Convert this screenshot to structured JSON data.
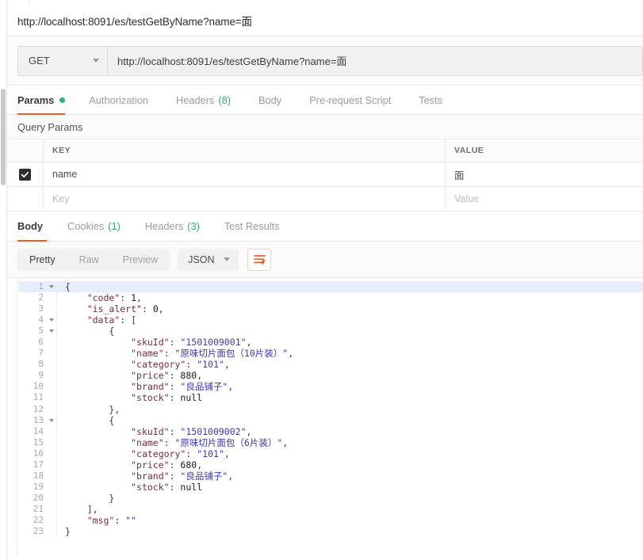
{
  "window": {
    "title_url": "http://localhost:8091/es/testGetByName?name=面"
  },
  "request": {
    "method": "GET",
    "method_caret": "chevron-down-icon",
    "url": "http://localhost:8091/es/testGetByName?name=面",
    "tabs": [
      {
        "label": "Params",
        "active": true,
        "dot": true,
        "count": ""
      },
      {
        "label": "Authorization",
        "active": false,
        "dot": false,
        "count": ""
      },
      {
        "label": "Headers",
        "active": false,
        "dot": false,
        "count": "(8)"
      },
      {
        "label": "Body",
        "active": false,
        "dot": false,
        "count": ""
      },
      {
        "label": "Pre-request Script",
        "active": false,
        "dot": false,
        "count": ""
      },
      {
        "label": "Tests",
        "active": false,
        "dot": false,
        "count": ""
      }
    ]
  },
  "query_params": {
    "section_label": "Query Params",
    "columns": {
      "key": "KEY",
      "value": "VALUE"
    },
    "rows": [
      {
        "checked": true,
        "key": "name",
        "value": "面",
        "placeholder_key": "",
        "placeholder_value": ""
      },
      {
        "checked": false,
        "key": "",
        "value": "",
        "placeholder_key": "Key",
        "placeholder_value": "Value"
      }
    ]
  },
  "response": {
    "tabs": [
      {
        "label": "Body",
        "active": true,
        "count": ""
      },
      {
        "label": "Cookies",
        "active": false,
        "count": "(1)"
      },
      {
        "label": "Headers",
        "active": false,
        "count": "(3)"
      },
      {
        "label": "Test Results",
        "active": false,
        "count": ""
      }
    ],
    "view_modes": [
      {
        "label": "Pretty",
        "active": true
      },
      {
        "label": "Raw",
        "active": false
      },
      {
        "label": "Preview",
        "active": false
      }
    ],
    "format": "JSON",
    "format_caret": "chevron-down-icon",
    "wrap_toggle": "word-wrap-icon",
    "body_lines": [
      {
        "n": 1,
        "fold": true,
        "indent": 0,
        "tokens": [
          {
            "t": "punc",
            "v": "{"
          }
        ]
      },
      {
        "n": 2,
        "fold": false,
        "indent": 1,
        "tokens": [
          {
            "t": "key",
            "v": "\"code\""
          },
          {
            "t": "punc",
            "v": ": "
          },
          {
            "t": "num",
            "v": "1"
          },
          {
            "t": "punc",
            "v": ","
          }
        ]
      },
      {
        "n": 3,
        "fold": false,
        "indent": 1,
        "tokens": [
          {
            "t": "key",
            "v": "\"is_alert\""
          },
          {
            "t": "punc",
            "v": ": "
          },
          {
            "t": "num",
            "v": "0"
          },
          {
            "t": "punc",
            "v": ","
          }
        ]
      },
      {
        "n": 4,
        "fold": true,
        "indent": 1,
        "tokens": [
          {
            "t": "key",
            "v": "\"data\""
          },
          {
            "t": "punc",
            "v": ": ["
          }
        ]
      },
      {
        "n": 5,
        "fold": true,
        "indent": 2,
        "tokens": [
          {
            "t": "punc",
            "v": "{"
          }
        ]
      },
      {
        "n": 6,
        "fold": false,
        "indent": 3,
        "tokens": [
          {
            "t": "key",
            "v": "\"skuId\""
          },
          {
            "t": "punc",
            "v": ": "
          },
          {
            "t": "str",
            "v": "\"1501009001\""
          },
          {
            "t": "punc",
            "v": ","
          }
        ]
      },
      {
        "n": 7,
        "fold": false,
        "indent": 3,
        "tokens": [
          {
            "t": "key",
            "v": "\"name\""
          },
          {
            "t": "punc",
            "v": ": "
          },
          {
            "t": "str",
            "v": "\"原味切片面包（10片装）\""
          },
          {
            "t": "punc",
            "v": ","
          }
        ]
      },
      {
        "n": 8,
        "fold": false,
        "indent": 3,
        "tokens": [
          {
            "t": "key",
            "v": "\"category\""
          },
          {
            "t": "punc",
            "v": ": "
          },
          {
            "t": "str",
            "v": "\"101\""
          },
          {
            "t": "punc",
            "v": ","
          }
        ]
      },
      {
        "n": 9,
        "fold": false,
        "indent": 3,
        "tokens": [
          {
            "t": "key",
            "v": "\"price\""
          },
          {
            "t": "punc",
            "v": ": "
          },
          {
            "t": "num",
            "v": "880"
          },
          {
            "t": "punc",
            "v": ","
          }
        ]
      },
      {
        "n": 10,
        "fold": false,
        "indent": 3,
        "tokens": [
          {
            "t": "key",
            "v": "\"brand\""
          },
          {
            "t": "punc",
            "v": ": "
          },
          {
            "t": "str",
            "v": "\"良品铺子\""
          },
          {
            "t": "punc",
            "v": ","
          }
        ]
      },
      {
        "n": 11,
        "fold": false,
        "indent": 3,
        "tokens": [
          {
            "t": "key",
            "v": "\"stock\""
          },
          {
            "t": "punc",
            "v": ": "
          },
          {
            "t": "null",
            "v": "null"
          }
        ]
      },
      {
        "n": 12,
        "fold": false,
        "indent": 2,
        "tokens": [
          {
            "t": "punc",
            "v": "},"
          }
        ]
      },
      {
        "n": 13,
        "fold": true,
        "indent": 2,
        "tokens": [
          {
            "t": "punc",
            "v": "{"
          }
        ]
      },
      {
        "n": 14,
        "fold": false,
        "indent": 3,
        "tokens": [
          {
            "t": "key",
            "v": "\"skuId\""
          },
          {
            "t": "punc",
            "v": ": "
          },
          {
            "t": "str",
            "v": "\"1501009002\""
          },
          {
            "t": "punc",
            "v": ","
          }
        ]
      },
      {
        "n": 15,
        "fold": false,
        "indent": 3,
        "tokens": [
          {
            "t": "key",
            "v": "\"name\""
          },
          {
            "t": "punc",
            "v": ": "
          },
          {
            "t": "str",
            "v": "\"原味切片面包（6片装）\""
          },
          {
            "t": "punc",
            "v": ","
          }
        ]
      },
      {
        "n": 16,
        "fold": false,
        "indent": 3,
        "tokens": [
          {
            "t": "key",
            "v": "\"category\""
          },
          {
            "t": "punc",
            "v": ": "
          },
          {
            "t": "str",
            "v": "\"101\""
          },
          {
            "t": "punc",
            "v": ","
          }
        ]
      },
      {
        "n": 17,
        "fold": false,
        "indent": 3,
        "tokens": [
          {
            "t": "key",
            "v": "\"price\""
          },
          {
            "t": "punc",
            "v": ": "
          },
          {
            "t": "num",
            "v": "680"
          },
          {
            "t": "punc",
            "v": ","
          }
        ]
      },
      {
        "n": 18,
        "fold": false,
        "indent": 3,
        "tokens": [
          {
            "t": "key",
            "v": "\"brand\""
          },
          {
            "t": "punc",
            "v": ": "
          },
          {
            "t": "str",
            "v": "\"良品铺子\""
          },
          {
            "t": "punc",
            "v": ","
          }
        ]
      },
      {
        "n": 19,
        "fold": false,
        "indent": 3,
        "tokens": [
          {
            "t": "key",
            "v": "\"stock\""
          },
          {
            "t": "punc",
            "v": ": "
          },
          {
            "t": "null",
            "v": "null"
          }
        ]
      },
      {
        "n": 20,
        "fold": false,
        "indent": 2,
        "tokens": [
          {
            "t": "punc",
            "v": "}"
          }
        ]
      },
      {
        "n": 21,
        "fold": false,
        "indent": 1,
        "tokens": [
          {
            "t": "punc",
            "v": "],"
          }
        ]
      },
      {
        "n": 22,
        "fold": false,
        "indent": 1,
        "tokens": [
          {
            "t": "key",
            "v": "\"msg\""
          },
          {
            "t": "punc",
            "v": ": "
          },
          {
            "t": "str",
            "v": "\"\""
          }
        ]
      },
      {
        "n": 23,
        "fold": false,
        "indent": 0,
        "tokens": [
          {
            "t": "punc",
            "v": "}"
          }
        ]
      }
    ]
  },
  "colors": {
    "accent_orange": "#ef5b25",
    "dot_green": "#2bb673",
    "json_key": "#7b2a3d",
    "json_string": "#3b39b8",
    "line_highlight": "#e7eefb"
  }
}
